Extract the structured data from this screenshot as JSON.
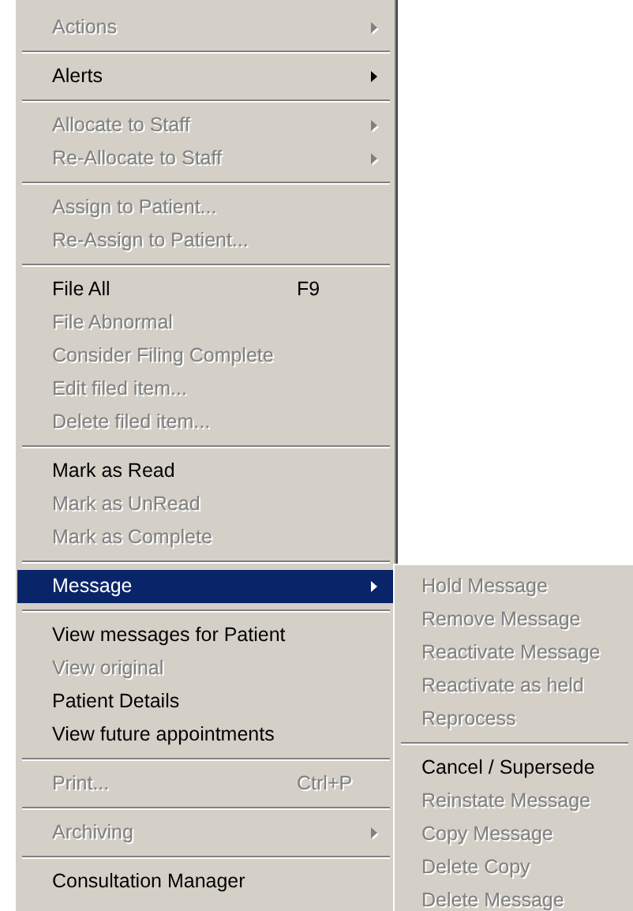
{
  "menu": {
    "groups": [
      [
        {
          "label": "Actions",
          "disabled": true,
          "submenu": true,
          "selected": false
        }
      ],
      [
        {
          "label": "Alerts",
          "disabled": false,
          "submenu": true,
          "selected": false
        }
      ],
      [
        {
          "label": "Allocate to Staff",
          "disabled": true,
          "submenu": true,
          "selected": false
        },
        {
          "label": "Re-Allocate to Staff",
          "disabled": true,
          "submenu": true,
          "selected": false
        }
      ],
      [
        {
          "label": "Assign to Patient...",
          "disabled": true,
          "submenu": false,
          "selected": false
        },
        {
          "label": "Re-Assign to Patient...",
          "disabled": true,
          "submenu": false,
          "selected": false
        }
      ],
      [
        {
          "label": "File All",
          "shortcut": "F9",
          "disabled": false,
          "submenu": false,
          "selected": false
        },
        {
          "label": "File Abnormal",
          "disabled": true,
          "submenu": false,
          "selected": false
        },
        {
          "label": "Consider Filing Complete",
          "disabled": true,
          "submenu": false,
          "selected": false
        },
        {
          "label": "Edit filed item...",
          "disabled": true,
          "submenu": false,
          "selected": false
        },
        {
          "label": "Delete filed item...",
          "disabled": true,
          "submenu": false,
          "selected": false
        }
      ],
      [
        {
          "label": "Mark as Read",
          "disabled": false,
          "submenu": false,
          "selected": false
        },
        {
          "label": "Mark as UnRead",
          "disabled": true,
          "submenu": false,
          "selected": false
        },
        {
          "label": "Mark as Complete",
          "disabled": true,
          "submenu": false,
          "selected": false
        }
      ],
      [
        {
          "label": "Message",
          "disabled": false,
          "submenu": true,
          "selected": true
        }
      ],
      [
        {
          "label": "View messages for Patient",
          "disabled": false,
          "submenu": false,
          "selected": false
        },
        {
          "label": "View original",
          "disabled": true,
          "submenu": false,
          "selected": false
        },
        {
          "label": "Patient Details",
          "disabled": false,
          "submenu": false,
          "selected": false
        },
        {
          "label": "View future appointments",
          "disabled": false,
          "submenu": false,
          "selected": false
        }
      ],
      [
        {
          "label": "Print...",
          "shortcut": "Ctrl+P",
          "disabled": true,
          "submenu": false,
          "selected": false
        }
      ],
      [
        {
          "label": "Archiving",
          "disabled": true,
          "submenu": true,
          "selected": false
        }
      ],
      [
        {
          "label": "Consultation Manager",
          "disabled": false,
          "submenu": false,
          "selected": false
        }
      ]
    ]
  },
  "submenu": {
    "groups": [
      [
        {
          "label": "Hold Message",
          "disabled": true
        },
        {
          "label": "Remove Message",
          "disabled": true
        },
        {
          "label": "Reactivate Message",
          "disabled": true
        },
        {
          "label": "Reactivate as held",
          "disabled": true
        },
        {
          "label": "Reprocess",
          "disabled": true
        }
      ],
      [
        {
          "label": "Cancel / Supersede",
          "disabled": false
        },
        {
          "label": "Reinstate Message",
          "disabled": true
        },
        {
          "label": "Copy Message",
          "disabled": true
        },
        {
          "label": "Delete Copy",
          "disabled": true
        },
        {
          "label": "Delete Message",
          "disabled": true
        }
      ]
    ]
  }
}
